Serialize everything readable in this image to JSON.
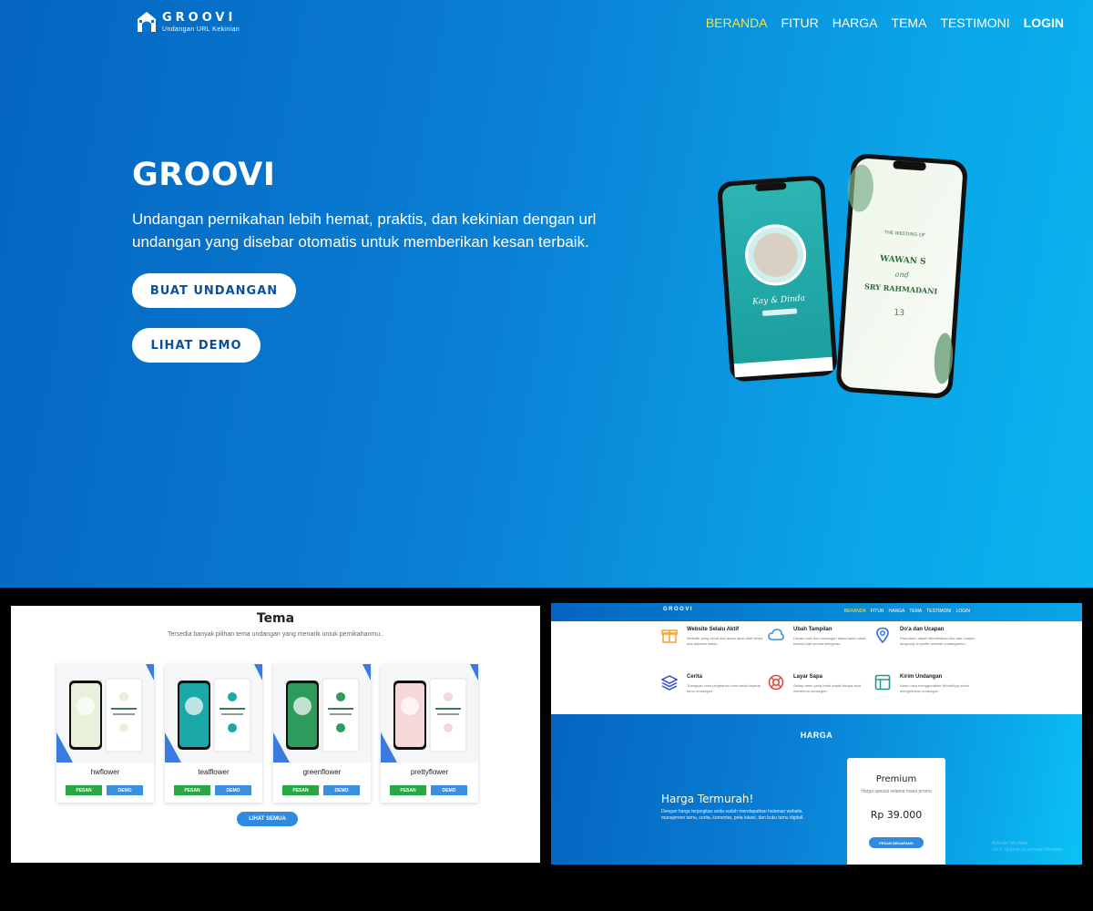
{
  "nav": {
    "brand": "GROOVI",
    "tagline": "Undangan URL Kekinian",
    "items": [
      "BERANDA",
      "FITUR",
      "HARGA",
      "TEMA",
      "TESTIMONI",
      "LOGIN"
    ]
  },
  "hero": {
    "title": "GROOVI",
    "subtitle": "Undangan pernikahan lebih hemat, praktis, dan kekinian dengan url undangan yang disebar otomatis untuk memberikan kesan terbaik.",
    "primary_button": "BUAT UNDANGAN",
    "secondary_button": "LIHAT DEMO"
  },
  "phones": {
    "left_names": "Kay & Dinda",
    "right_heading": "THE WEDDING OF",
    "right_groom": "WAWAN S",
    "right_and": "and",
    "right_bride": "SRY RAHMADANI",
    "right_date": "13"
  },
  "tema": {
    "title": "Tema",
    "subtitle": "Tersedia banyak pilihan tema undangan yang menarik untuk pernikahanmu..",
    "pesan_label": "PESAN",
    "demo_label": "DEMO",
    "themes": [
      {
        "name": "hwflower",
        "color": "#e9f1dc"
      },
      {
        "name": "tealflower",
        "color": "#1aa9a6"
      },
      {
        "name": "greenflower",
        "color": "#2e9a5c"
      },
      {
        "name": "prettyflower",
        "color": "#f6d8d8"
      }
    ],
    "all_button": "LIHAT SEMUA"
  },
  "mini_nav": {
    "brand": "GROOVI",
    "items": [
      "BERANDA",
      "FITUR",
      "HARGA",
      "TEMA",
      "TESTIMONI",
      "LOGIN"
    ]
  },
  "features": [
    {
      "title": "Website Selalu Aktif",
      "desc": "Website yang cepat dan aman akan aktif tanpa ada batasan waktu.",
      "icon": "gift-icon",
      "color": "#f2a93b"
    },
    {
      "title": "Ubah Tampilan",
      "desc": "Desain web dan undangan dapat kamu ubah sesuka hati sesuai keinginan.",
      "icon": "cloud-icon",
      "color": "#3a8fe0"
    },
    {
      "title": "Do'a dan Ucapan",
      "desc": "Para tamu dapat memberikan doa dan ucapan langsung di profile website undanganmu.",
      "icon": "location-pin-icon",
      "color": "#2f6de0"
    },
    {
      "title": "Cerita",
      "desc": "Tuangkan cinta perjalanan cinta anda kepada tamu undangan.",
      "icon": "layers-icon",
      "color": "#3b4ad8"
    },
    {
      "title": "Layar Sapa",
      "desc": "Setiap tamu yang hadir dapat disapa saat menerima undangan.",
      "icon": "lifebuoy-icon",
      "color": "#e04a3a"
    },
    {
      "title": "Kirim Undangan",
      "desc": "Kamu bisa menggunakan WhatsApp untuk mengirimkan undangan.",
      "icon": "layout-icon",
      "color": "#1f9a8a"
    }
  ],
  "harga": {
    "label": "HARGA",
    "title": "Harga Termurah!",
    "desc": "Dengan harga terjangkau anda sudah mendapatkan halaman website, manajemen tamu, cerita, komentar, peta lokasi, dan buku tamu digitall.",
    "plan_name": "Premium",
    "plan_sub": "Harga spesial selama masa promo",
    "plan_price": "Rp 39.000",
    "plan_button": "PESAN SEKARANG",
    "watermark_line1": "Activate Windows",
    "watermark_line2": "Go to Settings to activate Windows."
  }
}
